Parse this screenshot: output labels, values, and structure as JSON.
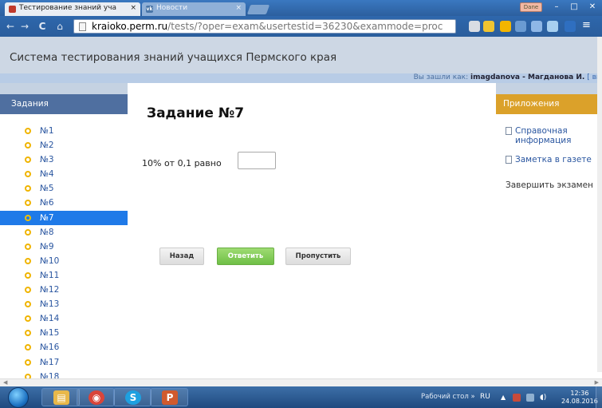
{
  "browser": {
    "tabs": [
      {
        "title": "Тестирование знаний уча",
        "active": true
      },
      {
        "title": "Новости",
        "active": false
      }
    ],
    "tab_close_glyph": "×",
    "user_badge": "Dane",
    "window_controls": [
      "–",
      "□",
      "✕"
    ],
    "nav": {
      "back": "←",
      "forward": "→",
      "reload": "C",
      "home": "⌂"
    },
    "url_host": "kraioko.perm.ru",
    "url_path": "/tests/?oper=exam&usertestid=36230&exammode=proc",
    "vk_glyph": "vk"
  },
  "site": {
    "title": "Система тестирования знаний учащихся Пермского края",
    "login_prefix": "Вы зашли как: ",
    "login_user": "imagdanova - Магданова И.",
    "login_tail": " [ вы"
  },
  "left_panel": {
    "header": "Задания",
    "items": [
      "№1",
      "№2",
      "№3",
      "№4",
      "№5",
      "№6",
      "№7",
      "№8",
      "№9",
      "№10",
      "№11",
      "№12",
      "№13",
      "№14",
      "№15",
      "№16",
      "№17",
      "№18"
    ],
    "active_index": 6
  },
  "main": {
    "task_title": "Задание №7",
    "question": "10% от 0,1 равно",
    "answer_value": "",
    "buttons": {
      "back": "Назад",
      "answer": "Ответить",
      "skip": "Пропустить"
    }
  },
  "right_panel": {
    "header": "Приложения",
    "links": [
      {
        "label_line1": "Справочная",
        "label_line2": "информация"
      },
      {
        "label_line1": "Заметка в газете",
        "label_line2": ""
      }
    ],
    "finish": "Завершить экзамен"
  },
  "taskbar": {
    "desktop_label": "Рабочий стол",
    "overflow_glyph": "»",
    "lang": "RU",
    "time": "12:36",
    "date": "24.08.2016",
    "apps": [
      {
        "name": "explorer",
        "glyph": "▤",
        "color": "#e8b84a"
      },
      {
        "name": "chrome",
        "glyph": "◉",
        "color": "#d9453a"
      },
      {
        "name": "skype",
        "glyph": "S",
        "color": "#1ea0e0"
      },
      {
        "name": "powerpoint",
        "glyph": "P",
        "color": "#d05a2e"
      }
    ]
  },
  "colors": {
    "left_header": "#4f6fa0",
    "right_header": "#dba12a",
    "active_item": "#1f7ae8",
    "answer_button": "#6fbf46"
  }
}
